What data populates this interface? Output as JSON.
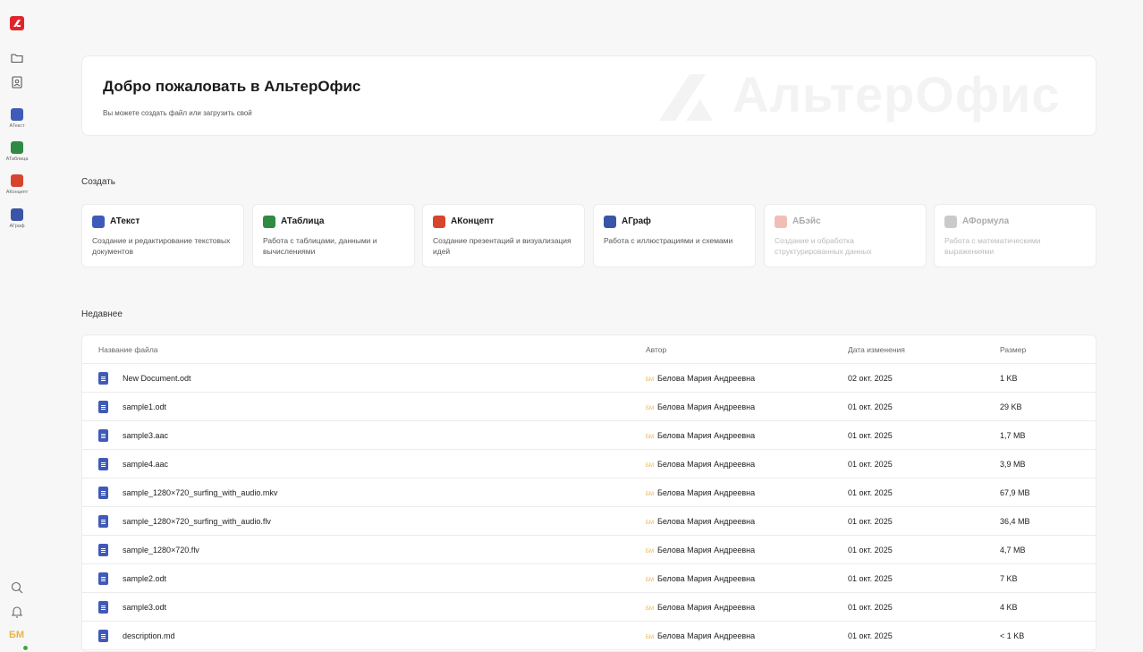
{
  "sidebar": {
    "apps": [
      {
        "label": "АТекст",
        "color": "#3f5ab8"
      },
      {
        "label": "АТаблица",
        "color": "#2f8a43"
      },
      {
        "label": "АКонцепт",
        "color": "#d7452c"
      },
      {
        "label": "АГраф",
        "color": "#3a55a8"
      }
    ],
    "avatar_initials": "БМ"
  },
  "welcome": {
    "title": "Добро пожаловать в АльтерОфис",
    "subtitle": "Вы можете создать файл или загрузить свой",
    "watermark": "АльтерОфис"
  },
  "create": {
    "section_title": "Создать",
    "cards": [
      {
        "name": "АТекст",
        "desc": "Создание и редактирование текстовых документов",
        "color": "#3f5ab8",
        "enabled": true
      },
      {
        "name": "АТаблица",
        "desc": "Работа с таблицами, данными и вычислениями",
        "color": "#2f8a43",
        "enabled": true
      },
      {
        "name": "АКонцепт",
        "desc": "Создание презентаций и визуализация идей",
        "color": "#d7452c",
        "enabled": true
      },
      {
        "name": "АГраф",
        "desc": "Работа с иллюстрациями и схемами",
        "color": "#3a55a8",
        "enabled": true
      },
      {
        "name": "АБэйс",
        "desc": "Создание и обработка структурированных данных",
        "color": "#d7452c",
        "enabled": false
      },
      {
        "name": "АФормула",
        "desc": "Работа с математическими выражениями",
        "color": "#666666",
        "enabled": false
      }
    ]
  },
  "recent": {
    "section_title": "Недавнее",
    "columns": {
      "name": "Название файла",
      "author": "Автор",
      "date": "Дата изменения",
      "size": "Размер"
    },
    "rows": [
      {
        "name": "New Document.odt",
        "initials": "БМ",
        "author": "Белова Мария Андреевна",
        "date": "02 окт. 2025",
        "size": "1 KB"
      },
      {
        "name": "sample1.odt",
        "initials": "БМ",
        "author": "Белова Мария Андреевна",
        "date": "01 окт. 2025",
        "size": "29 KB"
      },
      {
        "name": "sample3.aac",
        "initials": "БМ",
        "author": "Белова Мария Андреевна",
        "date": "01 окт. 2025",
        "size": "1,7 MB"
      },
      {
        "name": "sample4.aac",
        "initials": "БМ",
        "author": "Белова Мария Андреевна",
        "date": "01 окт. 2025",
        "size": "3,9 MB"
      },
      {
        "name": "sample_1280×720_surfing_with_audio.mkv",
        "initials": "БМ",
        "author": "Белова Мария Андреевна",
        "date": "01 окт. 2025",
        "size": "67,9 MB"
      },
      {
        "name": "sample_1280×720_surfing_with_audio.flv",
        "initials": "БМ",
        "author": "Белова Мария Андреевна",
        "date": "01 окт. 2025",
        "size": "36,4 MB"
      },
      {
        "name": "sample_1280×720.flv",
        "initials": "БМ",
        "author": "Белова Мария Андреевна",
        "date": "01 окт. 2025",
        "size": "4,7 MB"
      },
      {
        "name": "sample2.odt",
        "initials": "БМ",
        "author": "Белова Мария Андреевна",
        "date": "01 окт. 2025",
        "size": "7 KB"
      },
      {
        "name": "sample3.odt",
        "initials": "БМ",
        "author": "Белова Мария Андреевна",
        "date": "01 окт. 2025",
        "size": "4 KB"
      },
      {
        "name": "description.md",
        "initials": "БМ",
        "author": "Белова Мария Андреевна",
        "date": "01 окт. 2025",
        "size": "< 1 KB"
      }
    ]
  }
}
